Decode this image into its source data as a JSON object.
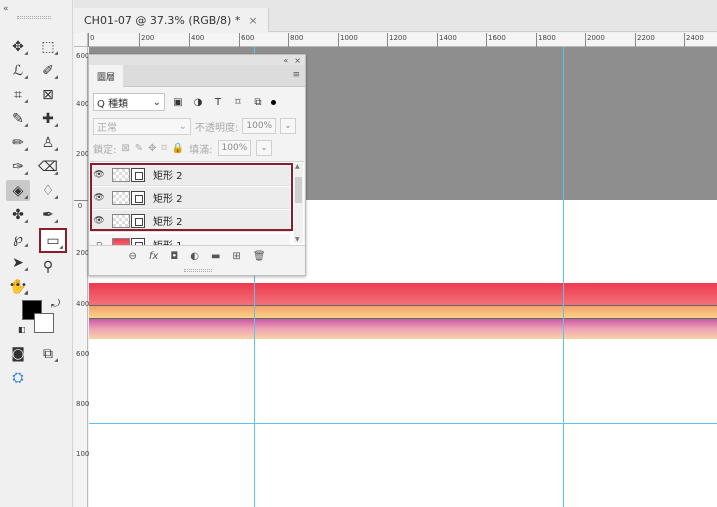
{
  "document": {
    "tab_title": "CH01-07 @ 37.3% (RGB/8) *",
    "close_glyph": "×"
  },
  "toolbar": {
    "collapse_glyph": "«",
    "tools": [
      {
        "name": "move-tool",
        "glyph": "✥"
      },
      {
        "name": "marquee-tool",
        "glyph": "⬚"
      },
      {
        "name": "lasso-tool",
        "glyph": "ℒ"
      },
      {
        "name": "quick-select-tool",
        "glyph": "✐"
      },
      {
        "name": "crop-tool",
        "glyph": "⌗"
      },
      {
        "name": "frame-tool",
        "glyph": "⊠"
      },
      {
        "name": "eyedropper-tool",
        "glyph": "✎"
      },
      {
        "name": "healing-brush-tool",
        "glyph": "✚"
      },
      {
        "name": "brush-tool",
        "glyph": "✏"
      },
      {
        "name": "clone-stamp-tool",
        "glyph": "♙"
      },
      {
        "name": "history-brush-tool",
        "glyph": "✑"
      },
      {
        "name": "eraser-tool",
        "glyph": "⌫"
      },
      {
        "name": "paint-bucket-tool",
        "glyph": "◈"
      },
      {
        "name": "blur-tool",
        "glyph": "♢"
      },
      {
        "name": "dodge-tool",
        "glyph": "✤"
      },
      {
        "name": "pen-tool",
        "glyph": "✒"
      },
      {
        "name": "path-select-tool",
        "glyph": "℘"
      },
      {
        "name": "type-tool",
        "glyph": "T"
      },
      {
        "name": "direct-select-tool",
        "glyph": "➤"
      },
      {
        "name": "rectangle-tool",
        "glyph": "▭"
      },
      {
        "name": "hand-tool",
        "glyph": "✋"
      },
      {
        "name": "zoom-tool",
        "glyph": "⚲"
      },
      {
        "name": "more-tools",
        "glyph": "•••"
      },
      {
        "name": "quick-mask",
        "glyph": "◙"
      },
      {
        "name": "screen-mode",
        "glyph": "⧉"
      },
      {
        "name": "edit-toolbar",
        "glyph": "⛭"
      }
    ]
  },
  "ruler": {
    "h_labels": [
      "0",
      "200",
      "400",
      "600",
      "800",
      "1000",
      "1200",
      "1400",
      "1600",
      "1800",
      "2000",
      "2200",
      "2400"
    ],
    "v_labels": [
      "600",
      "400",
      "200",
      "0",
      "200",
      "400",
      "600",
      "800",
      "1000"
    ]
  },
  "layers_panel": {
    "panel_top_collapse": "«",
    "panel_top_close": "×",
    "tab_label": "圖層",
    "menu_glyph": "≡",
    "filter": {
      "search_glyph": "Q",
      "kind_label": "種類",
      "chevron": "⌄",
      "icons": [
        "▣",
        "◑",
        "T",
        "⌑",
        "⧉"
      ]
    },
    "blend": {
      "mode": "正常",
      "opacity_label": "不透明度:",
      "opacity_value": "100%"
    },
    "lock": {
      "label": "鎖定:",
      "fill_label": "填滿:",
      "fill_value": "100%",
      "icons": [
        "⊠",
        "✎",
        "✥",
        "⌑",
        "🔒"
      ]
    },
    "layers": [
      {
        "name": "矩形 2",
        "visible": true
      },
      {
        "name": "矩形 2",
        "visible": true
      },
      {
        "name": "矩形 2",
        "visible": true
      },
      {
        "name": "矩形 1",
        "visible": false
      }
    ],
    "bottom_icons": [
      "⊖",
      "fx",
      "◘",
      "◐",
      "▬",
      "⊞",
      "🗑"
    ]
  }
}
